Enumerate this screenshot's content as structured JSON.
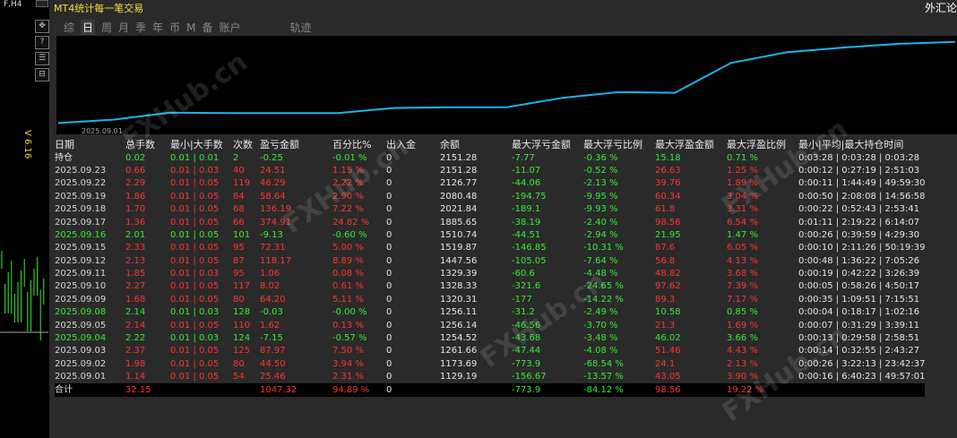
{
  "left_label": "F,H4",
  "right_label": "外汇论",
  "vertical_label": "V 6.16",
  "tools": [
    "✥",
    "?",
    "☰",
    "⊟"
  ],
  "title": "MT4统计每一笔交易",
  "tabs": [
    "综",
    "日",
    "周",
    "月",
    "季",
    "年",
    "币",
    "M",
    "备",
    "账户",
    "轨迹"
  ],
  "active_tab": "日",
  "chart_date": "2025.09.01",
  "watermark": "FXHub.cn",
  "colors": {
    "line": "#19b4f0",
    "positive": "#33ee33",
    "negative": "#ff3333",
    "title": "#f0e040"
  },
  "headers": [
    "日期",
    "总手数",
    "最小|大手数",
    "次数",
    "盈亏金额",
    "百分比%",
    "出入金",
    "余额",
    "最大浮亏金额",
    "最大浮亏比例",
    "最大浮盈金额",
    "最大浮盈比例",
    "最小|平均|最大持仓时间"
  ],
  "rows": [
    {
      "date": "持仓",
      "lots": "0.02",
      "minmax": "0.01 | 0.01",
      "count": "2",
      "pnl": "-0.25",
      "pct": "-0.01 %",
      "deposit": "0",
      "balance": "2151.28",
      "maxloss": "-7.77",
      "maxloss_pct": "-0.36 %",
      "maxprofit": "15.18",
      "maxprofit_pct": "0.71 %",
      "hold": "0:03:28 | 0:03:28 | 0:03:28",
      "c": "g"
    },
    {
      "date": "2025.09.23",
      "lots": "0.66",
      "minmax": "0.01 | 0.03",
      "count": "40",
      "pnl": "24.51",
      "pct": "1.15 %",
      "deposit": "0",
      "balance": "2151.28",
      "maxloss": "-11.07",
      "maxloss_pct": "-0.52 %",
      "maxprofit": "26.63",
      "maxprofit_pct": "1.25 %",
      "hold": "0:00:12 | 0:27:19 | 2:51:03",
      "c": "r"
    },
    {
      "date": "2025.09.22",
      "lots": "2.29",
      "minmax": "0.01 | 0.05",
      "count": "119",
      "pnl": "46.29",
      "pct": "2.22 %",
      "deposit": "0",
      "balance": "2126.77",
      "maxloss": "-44.06",
      "maxloss_pct": "-2.13 %",
      "maxprofit": "39.76",
      "maxprofit_pct": "1.89 %",
      "hold": "0:00:11 | 1:44:49 | 49:59:30",
      "c": "r"
    },
    {
      "date": "2025.09.19",
      "lots": "1.86",
      "minmax": "0.01 | 0.05",
      "count": "84",
      "pnl": "58.64",
      "pct": "2.90 %",
      "deposit": "0",
      "balance": "2080.48",
      "maxloss": "-194.75",
      "maxloss_pct": "-9.95 %",
      "maxprofit": "60.34",
      "maxprofit_pct": "3.04 %",
      "hold": "0:00:50 | 2:08:08 | 14:56:58",
      "c": "r"
    },
    {
      "date": "2025.09.18",
      "lots": "1.70",
      "minmax": "0.01 | 0.05",
      "count": "68",
      "pnl": "136.19",
      "pct": "7.22 %",
      "deposit": "0",
      "balance": "2021.84",
      "maxloss": "-189.1",
      "maxloss_pct": "-9.93 %",
      "maxprofit": "61.8",
      "maxprofit_pct": "3.31 %",
      "hold": "0:00:22 | 0:52:43 | 2:53:41",
      "c": "r"
    },
    {
      "date": "2025.09.17",
      "lots": "1.36",
      "minmax": "0.01 | 0.05",
      "count": "66",
      "pnl": "374.91",
      "pct": "24.82 %",
      "deposit": "0",
      "balance": "1885.65",
      "maxloss": "-38.19",
      "maxloss_pct": "-2.40 %",
      "maxprofit": "98.56",
      "maxprofit_pct": "6.54 %",
      "hold": "0:01:11 | 2:19:22 | 6:14:07",
      "c": "r"
    },
    {
      "date": "2025.09.16",
      "lots": "2.01",
      "minmax": "0.01 | 0.05",
      "count": "101",
      "pnl": "-9.13",
      "pct": "-0.60 %",
      "deposit": "0",
      "balance": "1510.74",
      "maxloss": "-44.51",
      "maxloss_pct": "-2.94 %",
      "maxprofit": "21.95",
      "maxprofit_pct": "1.47 %",
      "hold": "0:00:26 | 0:39:59 | 4:29:30",
      "c": "g"
    },
    {
      "date": "2025.09.15",
      "lots": "2.33",
      "minmax": "0.01 | 0.05",
      "count": "95",
      "pnl": "72.31",
      "pct": "5.00 %",
      "deposit": "0",
      "balance": "1519.87",
      "maxloss": "-146.85",
      "maxloss_pct": "-10.31 %",
      "maxprofit": "87.6",
      "maxprofit_pct": "6.05 %",
      "hold": "0:00:10 | 2:11:26 | 50:19:39",
      "c": "r"
    },
    {
      "date": "2025.09.12",
      "lots": "2.13",
      "minmax": "0.01 | 0.05",
      "count": "87",
      "pnl": "118.17",
      "pct": "8.89 %",
      "deposit": "0",
      "balance": "1447.56",
      "maxloss": "-105.05",
      "maxloss_pct": "-7.64 %",
      "maxprofit": "56.8",
      "maxprofit_pct": "4.13 %",
      "hold": "0:00:48 | 1:36:22 | 7:05:26",
      "c": "r"
    },
    {
      "date": "2025.09.11",
      "lots": "1.85",
      "minmax": "0.01 | 0.03",
      "count": "95",
      "pnl": "1.06",
      "pct": "0.08 %",
      "deposit": "0",
      "balance": "1329.39",
      "maxloss": "-60.6",
      "maxloss_pct": "-4.48 %",
      "maxprofit": "48.82",
      "maxprofit_pct": "3.68 %",
      "hold": "0:00:19 | 0:42:22 | 3:26:39",
      "c": "r"
    },
    {
      "date": "2025.09.10",
      "lots": "2.27",
      "minmax": "0.01 | 0.05",
      "count": "117",
      "pnl": "8.02",
      "pct": "0.61 %",
      "deposit": "0",
      "balance": "1328.33",
      "maxloss": "-321.6",
      "maxloss_pct": "-24.65 %",
      "maxprofit": "97.62",
      "maxprofit_pct": "7.39 %",
      "hold": "0:00:05 | 0:58:26 | 4:50:17",
      "c": "r"
    },
    {
      "date": "2025.09.09",
      "lots": "1.68",
      "minmax": "0.01 | 0.05",
      "count": "80",
      "pnl": "64.20",
      "pct": "5.11 %",
      "deposit": "0",
      "balance": "1320.31",
      "maxloss": "-177",
      "maxloss_pct": "-14.22 %",
      "maxprofit": "89.3",
      "maxprofit_pct": "7.17 %",
      "hold": "0:00:35 | 1:09:51 | 7:15:51",
      "c": "r"
    },
    {
      "date": "2025.09.08",
      "lots": "2.14",
      "minmax": "0.01 | 0.03",
      "count": "128",
      "pnl": "-0.03",
      "pct": "-0.00 %",
      "deposit": "0",
      "balance": "1256.11",
      "maxloss": "-31.2",
      "maxloss_pct": "-2.49 %",
      "maxprofit": "10.58",
      "maxprofit_pct": "0.85 %",
      "hold": "0:00:04 | 0:18:17 | 1:02:16",
      "c": "g"
    },
    {
      "date": "2025.09.05",
      "lots": "2.14",
      "minmax": "0.01 | 0.05",
      "count": "110",
      "pnl": "1.62",
      "pct": "0.13 %",
      "deposit": "0",
      "balance": "1256.14",
      "maxloss": "-46.56",
      "maxloss_pct": "-3.70 %",
      "maxprofit": "21.3",
      "maxprofit_pct": "1.69 %",
      "hold": "0:00:07 | 0:31:29 | 3:39:11",
      "c": "r"
    },
    {
      "date": "2025.09.04",
      "lots": "2.22",
      "minmax": "0.01 | 0.03",
      "count": "124",
      "pnl": "-7.15",
      "pct": "-0.57 %",
      "deposit": "0",
      "balance": "1254.52",
      "maxloss": "-43.68",
      "maxloss_pct": "-3.48 %",
      "maxprofit": "46.02",
      "maxprofit_pct": "3.66 %",
      "hold": "0:00:13 | 0:29:58 | 2:58:51",
      "c": "g"
    },
    {
      "date": "2025.09.03",
      "lots": "2.37",
      "minmax": "0.01 | 0.05",
      "count": "125",
      "pnl": "87.97",
      "pct": "7.50 %",
      "deposit": "0",
      "balance": "1261.66",
      "maxloss": "-47.44",
      "maxloss_pct": "-4.08 %",
      "maxprofit": "51.46",
      "maxprofit_pct": "4.43 %",
      "hold": "0:00:14 | 0:32:55 | 2:43:27",
      "c": "r"
    },
    {
      "date": "2025.09.02",
      "lots": "1.98",
      "minmax": "0.01 | 0.05",
      "count": "80",
      "pnl": "44.50",
      "pct": "3.94 %",
      "deposit": "0",
      "balance": "1173.69",
      "maxloss": "-773.9",
      "maxloss_pct": "-68.54 %",
      "maxprofit": "24.1",
      "maxprofit_pct": "2.13 %",
      "hold": "0:00:26 | 3:22:13 | 23:42:37",
      "c": "r"
    },
    {
      "date": "2025.09.01",
      "lots": "1.14",
      "minmax": "0.01 | 0.05",
      "count": "54",
      "pnl": "25.46",
      "pct": "2.31 %",
      "deposit": "0",
      "balance": "1129.19",
      "maxloss": "-156.67",
      "maxloss_pct": "-13.57 %",
      "maxprofit": "43.05",
      "maxprofit_pct": "3.90 %",
      "hold": "0:00:16 | 6:40:23 | 49:57:01",
      "c": "r"
    }
  ],
  "total": {
    "date": "合计",
    "lots": "32.15",
    "minmax": "",
    "count": "",
    "pnl": "1047.32",
    "pct": "94.89 %",
    "deposit": "0",
    "balance": "",
    "maxloss": "-773.9",
    "maxloss_pct": "-84.12 %",
    "maxprofit": "98.56",
    "maxprofit_pct": "19.22 %",
    "hold": ""
  }
}
